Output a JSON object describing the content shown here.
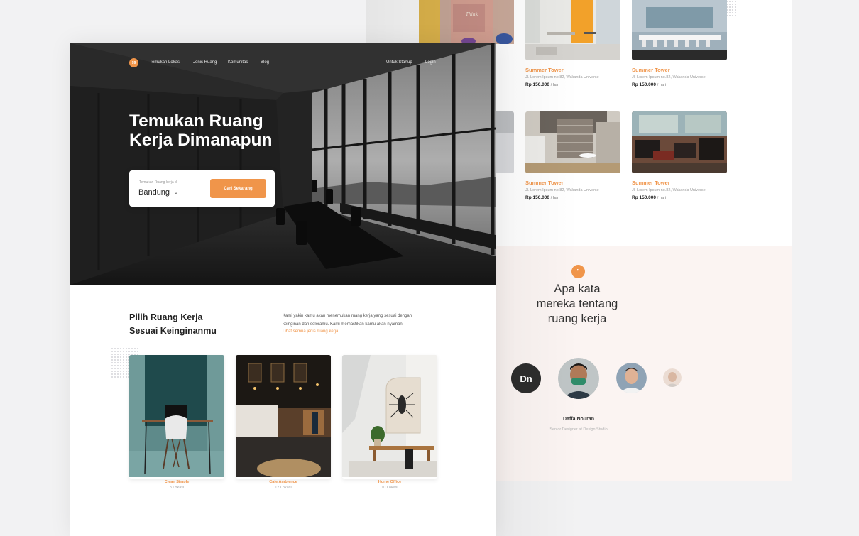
{
  "colors": {
    "accent": "#f0954a",
    "dark_text": "#222222",
    "muted_text": "#9a9a9a",
    "testimonial_bg": "#fbf4f2"
  },
  "nav": {
    "logo_text": "99",
    "links": [
      "Temukan Lokasi",
      "Jenis Ruang",
      "Komunitas",
      "Blog"
    ],
    "right_links": [
      "Untuk Startup",
      "Login"
    ]
  },
  "hero": {
    "title_line1": "Temukan Ruang",
    "title_line2": "Kerja Dimanapun",
    "search": {
      "label": "Temukan Ruang kerja di",
      "value": "Bandung",
      "button": "Cari Sekarang"
    }
  },
  "section": {
    "title_line1": "Pilih Ruang Kerja",
    "title_line2": "Sesuai Keinginanmu",
    "desc_line1": "Kami yakin kamu akan menemukan ruang kerja yang sesuai dengan",
    "desc_line2": "keinginan dan seleramu. Kami memastikan kamu akan nyaman.",
    "link": "Lihat semua jenis ruang kerja"
  },
  "categories": [
    {
      "name": "Clean Simple",
      "count": "8 Lokasi"
    },
    {
      "name": "Cafe Ambience",
      "count": "12 Lokasi"
    },
    {
      "name": "Home Office",
      "count": "10 Lokasi"
    }
  ],
  "listings": [
    {
      "title": "Summer Tower",
      "address": "Jl. Lorem Ipsum no.82, Wakanda Universe",
      "price": "Rp 150.000",
      "unit": "/ hari"
    },
    {
      "title": "Summer Tower",
      "address": "Jl. Lorem Ipsum no.82, Wakanda Universe",
      "price": "Rp 150.000",
      "unit": "/ hari"
    },
    {
      "title": "Summer Tower",
      "address": "Jl. Lorem Ipsum no.82, Wakanda Universe",
      "price": "Rp 150.000",
      "unit": "/ hari"
    },
    {
      "title": "Summer Tower",
      "address": "Jl. Lorem Ipsum no.82, Wakanda Universe",
      "price": "Rp 150.000",
      "unit": "/ hari"
    }
  ],
  "testimonial": {
    "quote_icon": "”",
    "title_line1": "Apa kata",
    "title_line2": "mereka tentang",
    "title_line3": "ruang kerja",
    "avatar_logo_text": "Dn",
    "name": "Daffa Nouran",
    "role": "Senior Designer at Design Studio"
  },
  "icons": {
    "dropdown": "chevron-down-icon",
    "quote": "quote-icon"
  }
}
